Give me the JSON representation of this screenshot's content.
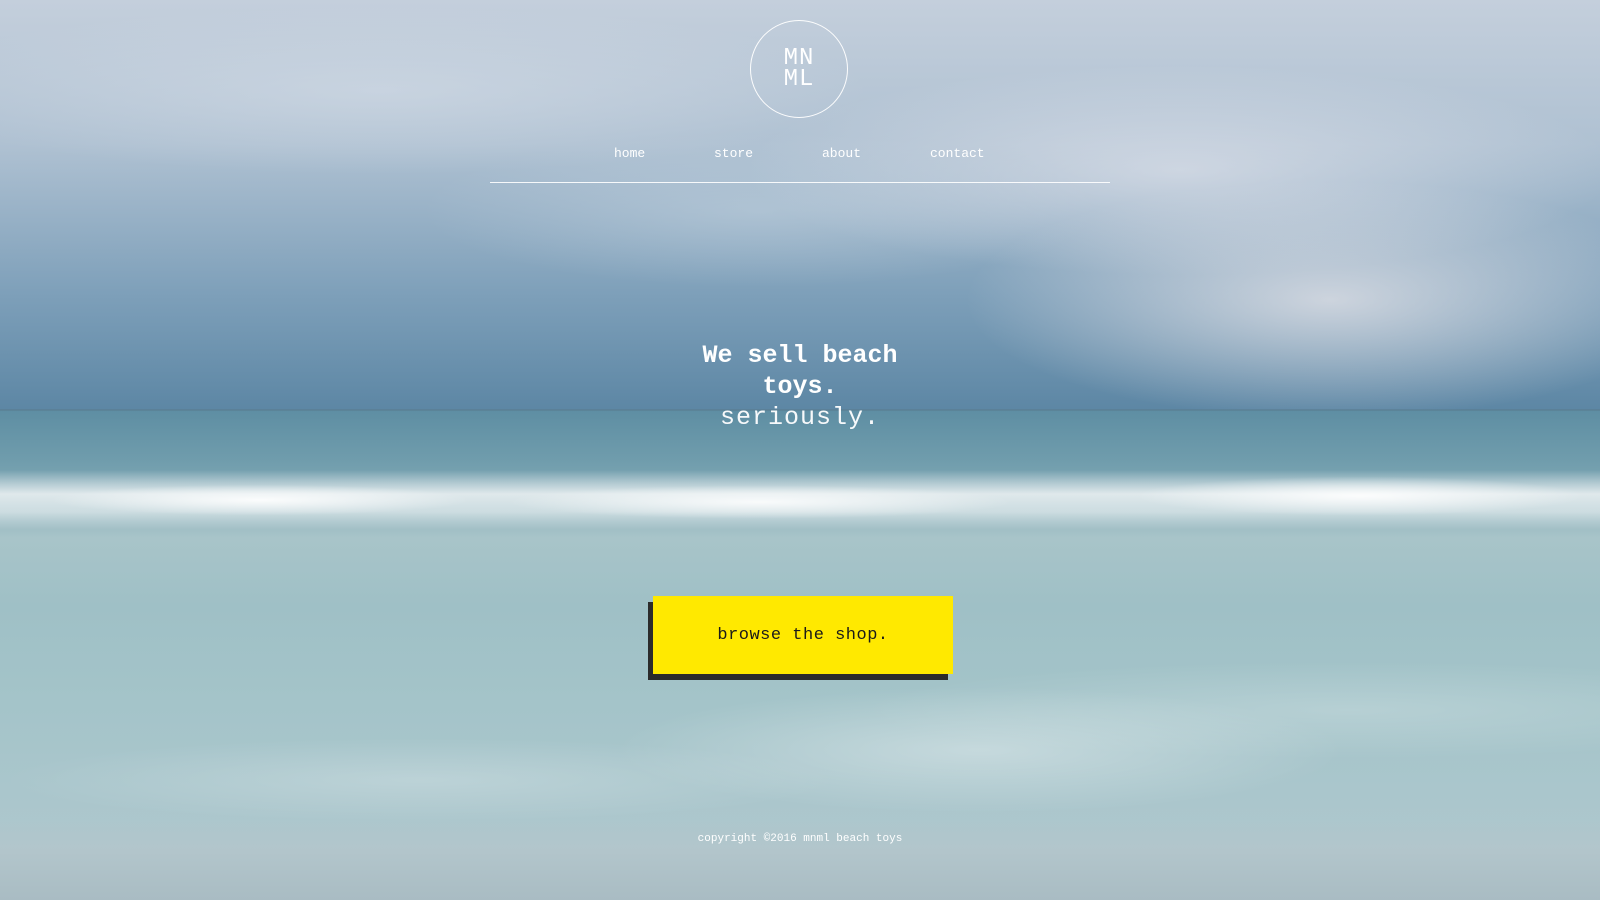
{
  "logo": {
    "line1": "MN",
    "line2": "ML"
  },
  "nav": {
    "items": [
      {
        "label": "home"
      },
      {
        "label": "store"
      },
      {
        "label": "about"
      },
      {
        "label": "contact"
      }
    ]
  },
  "hero": {
    "title": "We sell beach toys.",
    "subtitle": "seriously."
  },
  "cta": {
    "label": "browse the shop."
  },
  "footer": {
    "copyright": "copyright ©2016 mnml beach toys"
  },
  "colors": {
    "accent": "#ffe900",
    "cta_shadow": "#2b2b2b",
    "text": "#ffffff"
  }
}
